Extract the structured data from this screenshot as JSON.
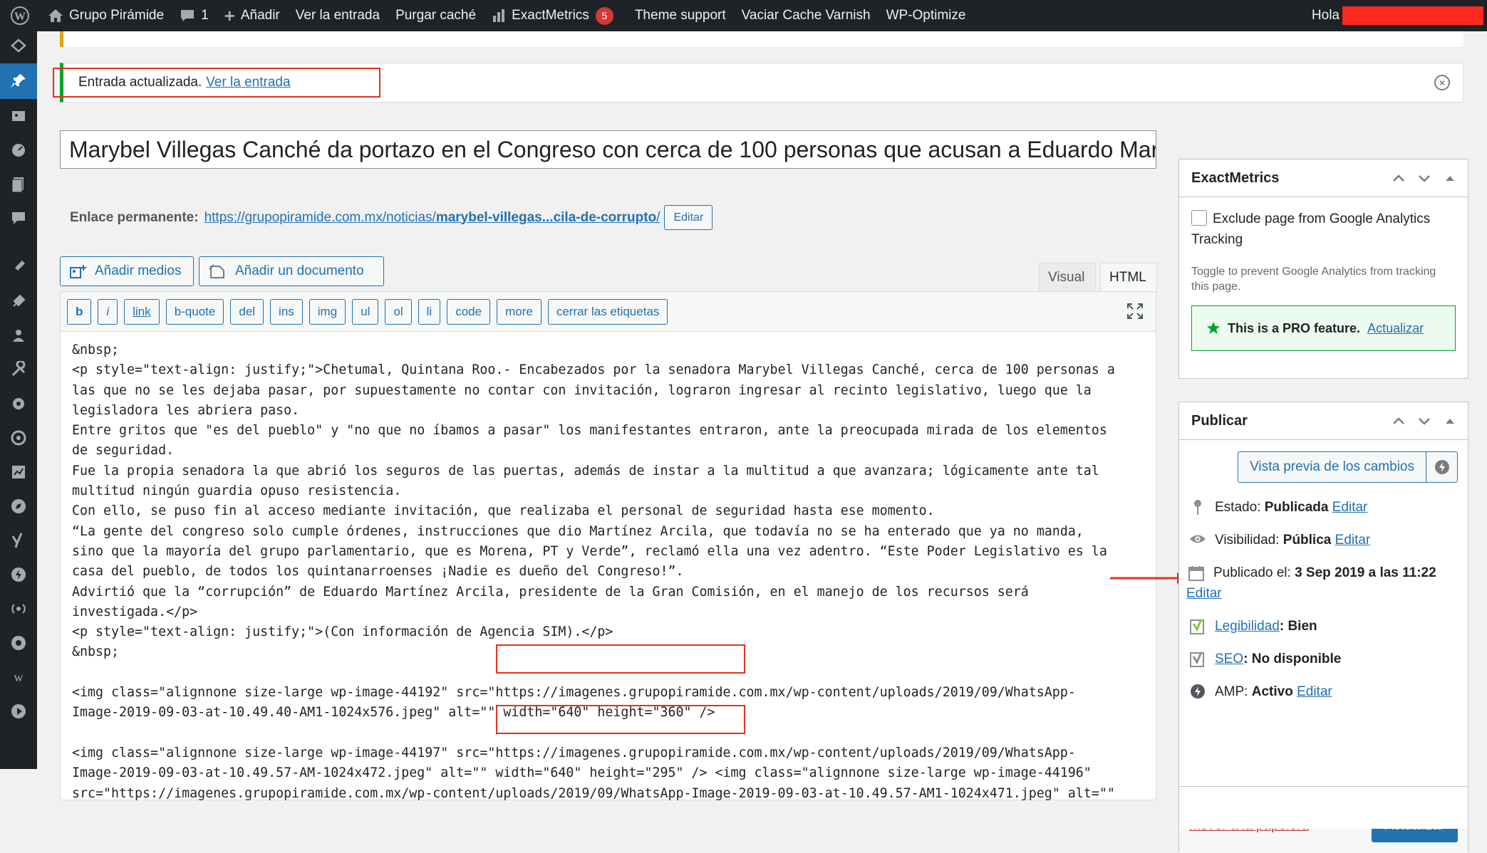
{
  "adminbar": {
    "site_name": "Grupo Pirámide",
    "comments_count": "1",
    "add_new": "Añadir",
    "view_post": "Ver la entrada",
    "purge_cache": "Purgar caché",
    "exactmetrics": "ExactMetrics",
    "exactmetrics_badge": "5",
    "theme_support": "Theme support",
    "varnish": "Vaciar Cache Varnish",
    "wp_optimize": "WP-Optimize",
    "howdy": "Hola"
  },
  "notice": {
    "text": "Entrada actualizada.",
    "link": "Ver la entrada"
  },
  "post": {
    "title": "Marybel Villegas Canché da portazo en el Congreso con cerca de 100 personas que acusan a Eduardo Mart",
    "permalink_label": "Enlace permanente:",
    "permalink_base": "https://grupopiramide.com.mx/noticias/",
    "permalink_slug": "marybel-villegas...cila-de-corrupto",
    "permalink_end": "/",
    "permalink_edit": "Editar"
  },
  "media": {
    "add_media": "Añadir medios",
    "add_document": "Añadir un documento"
  },
  "editor_tabs": {
    "visual": "Visual",
    "html": "HTML"
  },
  "quicktags": [
    "b",
    "i",
    "link",
    "b-quote",
    "del",
    "ins",
    "img",
    "ul",
    "ol",
    "li",
    "code",
    "more",
    "cerrar las etiquetas"
  ],
  "code_lines": [
    "&nbsp;",
    "<p style=\"text-align: justify;\">Chetumal, Quintana Roo.- Encabezados por la senadora Marybel Villegas Canché, cerca de 100 personas a",
    "las que no se les dejaba pasar, por supuestamente no contar con invitación, lograron ingresar al recinto legislativo, luego que la",
    "legisladora les abriera paso.",
    "Entre gritos que \"es del pueblo\" y \"no que no íbamos a pasar\" los manifestantes entraron, ante la preocupada mirada de los elementos",
    "de seguridad.",
    "Fue la propia senadora la que abrió los seguros de las puertas, además de instar a la multitud a que avanzara; lógicamente ante tal",
    "multitud ningún guardia opuso resistencia.",
    "Con ello, se puso fin al acceso mediante invitación, que realizaba el personal de seguridad hasta ese momento.",
    "“La gente del congreso solo cumple órdenes, instrucciones que dio Martínez Arcila, que todavía no se ha enterado que ya no manda,",
    "sino que la mayoría del grupo parlamentario, que es Morena, PT y Verde”, reclamó ella una vez adentro. “Este Poder Legislativo es la",
    "casa del pueblo, de todos los quintanarroenses ¡Nadie es dueño del Congreso!”.",
    "Advirtió que la “corrupción” de Eduardo Martínez Arcila, presidente de la Gran Comisión, en el manejo de los recursos será",
    "investigada.</p>",
    "<p style=\"text-align: justify;\">(Con información de Agencia SIM).</p>",
    "&nbsp;",
    "",
    "<img class=\"alignnone size-large wp-image-44192\" src=\"https://imagenes.grupopiramide.com.mx/wp-content/uploads/2019/09/WhatsApp-",
    "Image-2019-09-03-at-10.49.40-AM1-1024x576.jpeg\" alt=\"\" width=\"640\" height=\"360\" />",
    "",
    "<img class=\"alignnone size-large wp-image-44197\" src=\"https://imagenes.grupopiramide.com.mx/wp-content/uploads/2019/09/WhatsApp-",
    "Image-2019-09-03-at-10.49.57-AM-1024x472.jpeg\" alt=\"\" width=\"640\" height=\"295\" /> <img class=\"alignnone size-large wp-image-44196\"",
    "src=\"https://imagenes.grupopiramide.com.mx/wp-content/uploads/2019/09/WhatsApp-Image-2019-09-03-at-10.49.57-AM1-1024x471.jpeg\" alt=\"\""
  ],
  "exactmetrics_box": {
    "title": "ExactMetrics",
    "checkbox_label": "Exclude page from Google Analytics Tracking",
    "note": "Toggle to prevent Google Analytics from tracking this page.",
    "pro_text": "This is a PRO feature.",
    "pro_link": "Actualizar"
  },
  "publish_box": {
    "title": "Publicar",
    "preview": "Vista previa de los cambios",
    "status_label": "Estado:",
    "status_value": "Publicada",
    "visibility_label": "Visibilidad:",
    "visibility_value": "Pública",
    "published_label": "Publicado el:",
    "published_value": "3 Sep 2019 a las 11:22",
    "readability_label": "Legibilidad",
    "readability_value": ": Bien",
    "seo_label": "SEO",
    "seo_value": ": No disponible",
    "amp_label": "AMP:",
    "amp_value": "Activo",
    "edit": "Editar",
    "trash": "Mover a la papelera",
    "update": "Actualizar"
  },
  "colors": {
    "adminbar": "#1d2327",
    "accent": "#2271b1",
    "annotation_red": "#e0331e",
    "success_green": "#00a32a"
  }
}
